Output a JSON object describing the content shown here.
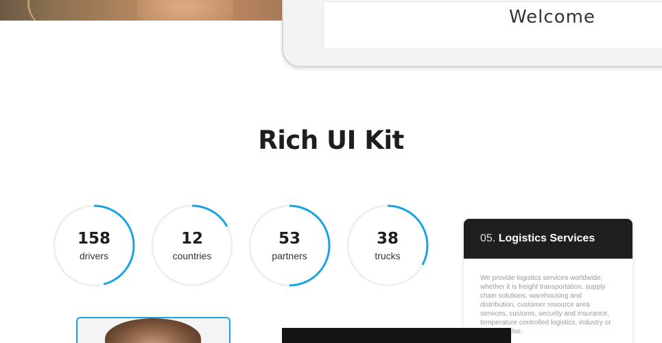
{
  "tablet": {
    "welcome": "Welcome"
  },
  "section": {
    "title": "Rich UI Kit"
  },
  "accent_color": "#19a3e6",
  "counters": [
    {
      "value": "158",
      "label": "drivers",
      "progress": 0.46
    },
    {
      "value": "12",
      "label": "countries",
      "progress": 0.17
    },
    {
      "value": "53",
      "label": "partners",
      "progress": 0.5
    },
    {
      "value": "38",
      "label": "trucks",
      "progress": 0.33
    }
  ],
  "service": {
    "number": "05.",
    "title": "Logistics Services",
    "text": "We provide logistics services worldwide, whether it is freight transportation, supply chain solutions, warehousing and distribution, customer resource area services, customs, security and insurance, temperature controlled logistics, industry or anything else."
  }
}
